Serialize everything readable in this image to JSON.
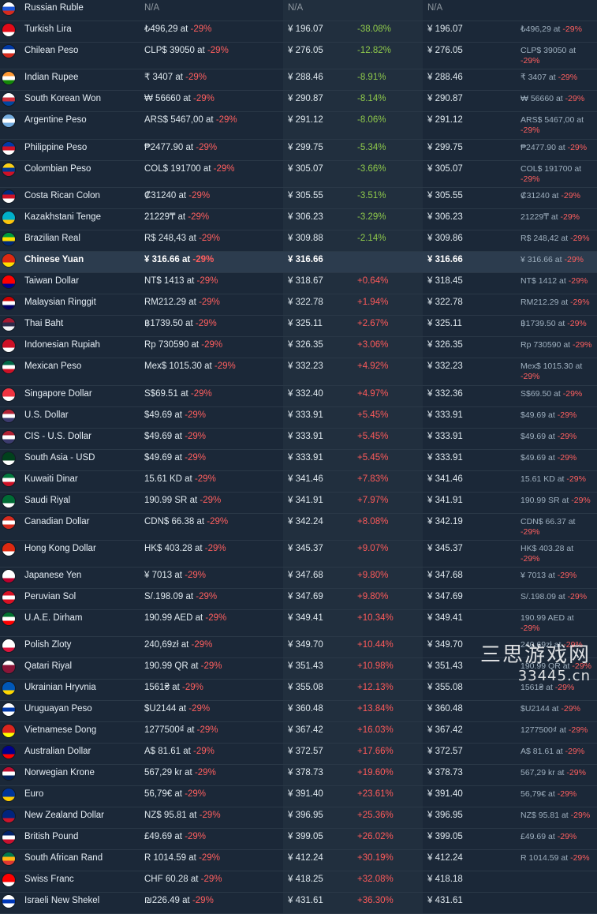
{
  "rows": [
    {
      "code": "ru",
      "name": "Russian Ruble",
      "price": "N/A",
      "cny": "N/A",
      "diff": "",
      "cny2": "N/A",
      "price2": "",
      "flag": [
        "#ffffff",
        "#1c57d8",
        "#d52b1e"
      ]
    },
    {
      "code": "tr",
      "name": "Turkish Lira",
      "price": "₺496,29",
      "cny": "¥ 196.07",
      "diff": "-38.08%",
      "cny2": "¥ 196.07",
      "price2": "₺496,29",
      "flag": [
        "#e30a17",
        "#e30a17",
        "#ffffff"
      ]
    },
    {
      "code": "cl",
      "name": "Chilean Peso",
      "price": "CLP$ 39050",
      "cny": "¥ 276.05",
      "diff": "-12.82%",
      "cny2": "¥ 276.05",
      "price2": "CLP$ 39050",
      "flag": [
        "#0039a6",
        "#ffffff",
        "#d52b1e"
      ]
    },
    {
      "code": "in",
      "name": "Indian Rupee",
      "price": "₹ 3407",
      "cny": "¥ 288.46",
      "diff": "-8.91%",
      "cny2": "¥ 288.46",
      "price2": "₹ 3407",
      "flag": [
        "#ff9933",
        "#ffffff",
        "#138808"
      ]
    },
    {
      "code": "kr",
      "name": "South Korean Won",
      "price": "₩ 56660",
      "cny": "¥ 290.87",
      "diff": "-8.14%",
      "cny2": "¥ 290.87",
      "price2": "₩ 56660",
      "flag": [
        "#ffffff",
        "#cd2e3a",
        "#0047a0"
      ]
    },
    {
      "code": "ar",
      "name": "Argentine Peso",
      "price": "ARS$ 5467,00",
      "cny": "¥ 291.12",
      "diff": "-8.06%",
      "cny2": "¥ 291.12",
      "price2": "ARS$ 5467,00",
      "flag": [
        "#74acdf",
        "#ffffff",
        "#74acdf"
      ],
      "tall": true
    },
    {
      "code": "ph",
      "name": "Philippine Peso",
      "price": "₱2477.90",
      "cny": "¥ 299.75",
      "diff": "-5.34%",
      "cny2": "¥ 299.75",
      "price2": "₱2477.90",
      "flag": [
        "#0038a8",
        "#ce1126",
        "#ffffff"
      ]
    },
    {
      "code": "co",
      "name": "Colombian Peso",
      "price": "COL$ 191700",
      "cny": "¥ 305.07",
      "diff": "-3.66%",
      "cny2": "¥ 305.07",
      "price2": "COL$ 191700",
      "flag": [
        "#fcd116",
        "#003893",
        "#ce1126"
      ]
    },
    {
      "code": "cr",
      "name": "Costa Rican Colon",
      "price": "₡31240",
      "cny": "¥ 305.55",
      "diff": "-3.51%",
      "cny2": "¥ 305.55",
      "price2": "₡31240",
      "flag": [
        "#002b7f",
        "#ce1126",
        "#ffffff"
      ]
    },
    {
      "code": "kz",
      "name": "Kazakhstani Tenge",
      "price": "21229₸",
      "cny": "¥ 306.23",
      "diff": "-3.29%",
      "cny2": "¥ 306.23",
      "price2": "21229₸",
      "flag": [
        "#00afca",
        "#00afca",
        "#fec50c"
      ]
    },
    {
      "code": "br",
      "name": "Brazilian Real",
      "price": "R$ 248,43",
      "cny": "¥ 309.88",
      "diff": "-2.14%",
      "cny2": "¥ 309.86",
      "price2": "R$ 248,42",
      "flag": [
        "#009c3b",
        "#ffdf00",
        "#002776"
      ]
    },
    {
      "code": "cn",
      "name": "Chinese Yuan",
      "price": "¥ 316.66",
      "cny": "¥ 316.66",
      "diff": "",
      "cny2": "¥ 316.66",
      "price2": "¥ 316.66",
      "flag": [
        "#de2910",
        "#de2910",
        "#ffde00"
      ],
      "highlight": true
    },
    {
      "code": "tw",
      "name": "Taiwan Dollar",
      "price": "NT$ 1413",
      "cny": "¥ 318.67",
      "diff": "+0.64%",
      "cny2": "¥ 318.45",
      "price2": "NT$ 1412",
      "flag": [
        "#fe0000",
        "#fe0000",
        "#000095"
      ]
    },
    {
      "code": "my",
      "name": "Malaysian Ringgit",
      "price": "RM212.29",
      "cny": "¥ 322.78",
      "diff": "+1.94%",
      "cny2": "¥ 322.78",
      "price2": "RM212.29",
      "flag": [
        "#cc0001",
        "#ffffff",
        "#010066"
      ]
    },
    {
      "code": "th",
      "name": "Thai Baht",
      "price": "฿1739.50",
      "cny": "¥ 325.11",
      "diff": "+2.67%",
      "cny2": "¥ 325.11",
      "price2": "฿1739.50",
      "flag": [
        "#a51931",
        "#2d2a4a",
        "#f4f5f8"
      ]
    },
    {
      "code": "id",
      "name": "Indonesian Rupiah",
      "price": "Rp 730590",
      "cny": "¥ 326.35",
      "diff": "+3.06%",
      "cny2": "¥ 326.35",
      "price2": "Rp 730590",
      "flag": [
        "#ce1126",
        "#ce1126",
        "#ffffff"
      ]
    },
    {
      "code": "mx",
      "name": "Mexican Peso",
      "price": "Mex$ 1015.30",
      "cny": "¥ 332.23",
      "diff": "+4.92%",
      "cny2": "¥ 332.23",
      "price2": "Mex$ 1015.30",
      "flag": [
        "#006847",
        "#ffffff",
        "#ce1126"
      ],
      "tall": true
    },
    {
      "code": "sg",
      "name": "Singapore Dollar",
      "price": "S$69.51",
      "cny": "¥ 332.40",
      "diff": "+4.97%",
      "cny2": "¥ 332.36",
      "price2": "S$69.50",
      "flag": [
        "#ef3340",
        "#ef3340",
        "#ffffff"
      ]
    },
    {
      "code": "us",
      "name": "U.S. Dollar",
      "price": "$49.69",
      "cny": "¥ 333.91",
      "diff": "+5.45%",
      "cny2": "¥ 333.91",
      "price2": "$49.69",
      "flag": [
        "#b22234",
        "#ffffff",
        "#3c3b6e"
      ]
    },
    {
      "code": "cis",
      "name": "CIS - U.S. Dollar",
      "price": "$49.69",
      "cny": "¥ 333.91",
      "diff": "+5.45%",
      "cny2": "¥ 333.91",
      "price2": "$49.69",
      "flag": [
        "#b22234",
        "#ffffff",
        "#3c3b6e"
      ]
    },
    {
      "code": "sa-usd",
      "name": "South Asia - USD",
      "price": "$49.69",
      "cny": "¥ 333.91",
      "diff": "+5.45%",
      "cny2": "¥ 333.91",
      "price2": "$49.69",
      "flag": [
        "#01411c",
        "#01411c",
        "#ffffff"
      ]
    },
    {
      "code": "kw",
      "name": "Kuwaiti Dinar",
      "price": "15.61 KD",
      "cny": "¥ 341.46",
      "diff": "+7.83%",
      "cny2": "¥ 341.46",
      "price2": "15.61 KD",
      "flag": [
        "#007a3d",
        "#ffffff",
        "#ce1126"
      ]
    },
    {
      "code": "sa",
      "name": "Saudi Riyal",
      "price": "190.99 SR",
      "cny": "¥ 341.91",
      "diff": "+7.97%",
      "cny2": "¥ 341.91",
      "price2": "190.99 SR",
      "flag": [
        "#006c35",
        "#006c35",
        "#ffffff"
      ]
    },
    {
      "code": "ca",
      "name": "Canadian Dollar",
      "price": "CDN$ 66.38",
      "cny": "¥ 342.24",
      "diff": "+8.08%",
      "cny2": "¥ 342.19",
      "price2": "CDN$ 66.37",
      "flag": [
        "#d52b1e",
        "#ffffff",
        "#d52b1e"
      ]
    },
    {
      "code": "hk",
      "name": "Hong Kong Dollar",
      "price": "HK$ 403.28",
      "cny": "¥ 345.37",
      "diff": "+9.07%",
      "cny2": "¥ 345.37",
      "price2": "HK$ 403.28",
      "flag": [
        "#de2910",
        "#de2910",
        "#ffffff"
      ]
    },
    {
      "code": "jp",
      "name": "Japanese Yen",
      "price": "¥ 7013",
      "cny": "¥ 347.68",
      "diff": "+9.80%",
      "cny2": "¥ 347.68",
      "price2": "¥ 7013",
      "flag": [
        "#ffffff",
        "#ffffff",
        "#bc002d"
      ]
    },
    {
      "code": "pe",
      "name": "Peruvian Sol",
      "price": "S/.198.09",
      "cny": "¥ 347.69",
      "diff": "+9.80%",
      "cny2": "¥ 347.69",
      "price2": "S/.198.09",
      "flag": [
        "#d91023",
        "#ffffff",
        "#d91023"
      ]
    },
    {
      "code": "ae",
      "name": "U.A.E. Dirham",
      "price": "190.99 AED",
      "cny": "¥ 349.41",
      "diff": "+10.34%",
      "cny2": "¥ 349.41",
      "price2": "190.99 AED",
      "flag": [
        "#00732f",
        "#ffffff",
        "#ff0000"
      ]
    },
    {
      "code": "pl",
      "name": "Polish Zloty",
      "price": "240,69zł",
      "cny": "¥ 349.70",
      "diff": "+10.44%",
      "cny2": "¥ 349.70",
      "price2": "240,69zł",
      "flag": [
        "#ffffff",
        "#ffffff",
        "#dc143c"
      ]
    },
    {
      "code": "qa",
      "name": "Qatari Riyal",
      "price": "190.99 QR",
      "cny": "¥ 351.43",
      "diff": "+10.98%",
      "cny2": "¥ 351.43",
      "price2": "190.99 QR",
      "flag": [
        "#ffffff",
        "#8a1538",
        "#8a1538"
      ]
    },
    {
      "code": "ua",
      "name": "Ukrainian Hryvnia",
      "price": "1561₴",
      "cny": "¥ 355.08",
      "diff": "+12.13%",
      "cny2": "¥ 355.08",
      "price2": "1561₴",
      "flag": [
        "#0057b7",
        "#0057b7",
        "#ffd700"
      ]
    },
    {
      "code": "uy",
      "name": "Uruguayan Peso",
      "price": "$U2144",
      "cny": "¥ 360.48",
      "diff": "+13.84%",
      "cny2": "¥ 360.48",
      "price2": "$U2144",
      "flag": [
        "#ffffff",
        "#0038a8",
        "#ffffff"
      ]
    },
    {
      "code": "vn",
      "name": "Vietnamese Dong",
      "price": "1277500₫",
      "cny": "¥ 367.42",
      "diff": "+16.03%",
      "cny2": "¥ 367.42",
      "price2": "1277500₫",
      "flag": [
        "#da251d",
        "#da251d",
        "#ffff00"
      ]
    },
    {
      "code": "au",
      "name": "Australian Dollar",
      "price": "A$ 81.61",
      "cny": "¥ 372.57",
      "diff": "+17.66%",
      "cny2": "¥ 372.57",
      "price2": "A$ 81.61",
      "flag": [
        "#00008b",
        "#00008b",
        "#ff0000"
      ]
    },
    {
      "code": "no",
      "name": "Norwegian Krone",
      "price": "567,29 kr",
      "cny": "¥ 378.73",
      "diff": "+19.60%",
      "cny2": "¥ 378.73",
      "price2": "567,29 kr",
      "flag": [
        "#ba0c2f",
        "#ffffff",
        "#00205b"
      ]
    },
    {
      "code": "eu",
      "name": "Euro",
      "price": "56,79€",
      "cny": "¥ 391.40",
      "diff": "+23.61%",
      "cny2": "¥ 391.40",
      "price2": "56,79€",
      "flag": [
        "#003399",
        "#003399",
        "#ffcc00"
      ]
    },
    {
      "code": "nz",
      "name": "New Zealand Dollar",
      "price": "NZ$ 95.81",
      "cny": "¥ 396.95",
      "diff": "+25.36%",
      "cny2": "¥ 396.95",
      "price2": "NZ$ 95.81",
      "flag": [
        "#00247d",
        "#00247d",
        "#cc142b"
      ]
    },
    {
      "code": "gb",
      "name": "British Pound",
      "price": "£49.69",
      "cny": "¥ 399.05",
      "diff": "+26.02%",
      "cny2": "¥ 399.05",
      "price2": "£49.69",
      "flag": [
        "#012169",
        "#ffffff",
        "#c8102e"
      ]
    },
    {
      "code": "za",
      "name": "South African Rand",
      "price": "R 1014.59",
      "cny": "¥ 412.24",
      "diff": "+30.19%",
      "cny2": "¥ 412.24",
      "price2": "R 1014.59",
      "flag": [
        "#007a4d",
        "#ffb612",
        "#de3831"
      ]
    },
    {
      "code": "ch",
      "name": "Swiss Franc",
      "price": "CHF 60.28",
      "cny": "¥ 418.25",
      "diff": "+32.08%",
      "cny2": "¥ 418.18",
      "price2": "",
      "flag": [
        "#ff0000",
        "#ff0000",
        "#ffffff"
      ]
    },
    {
      "code": "il",
      "name": "Israeli New Shekel",
      "price": "₪226.49",
      "cny": "¥ 431.61",
      "diff": "+36.30%",
      "cny2": "¥ 431.61",
      "price2": "",
      "flag": [
        "#ffffff",
        "#0038b8",
        "#ffffff"
      ]
    }
  ],
  "labels": {
    "at": "at",
    "discount": "-29%"
  },
  "watermark": {
    "line1": "三思游戏网",
    "line2": "33445.cn"
  }
}
